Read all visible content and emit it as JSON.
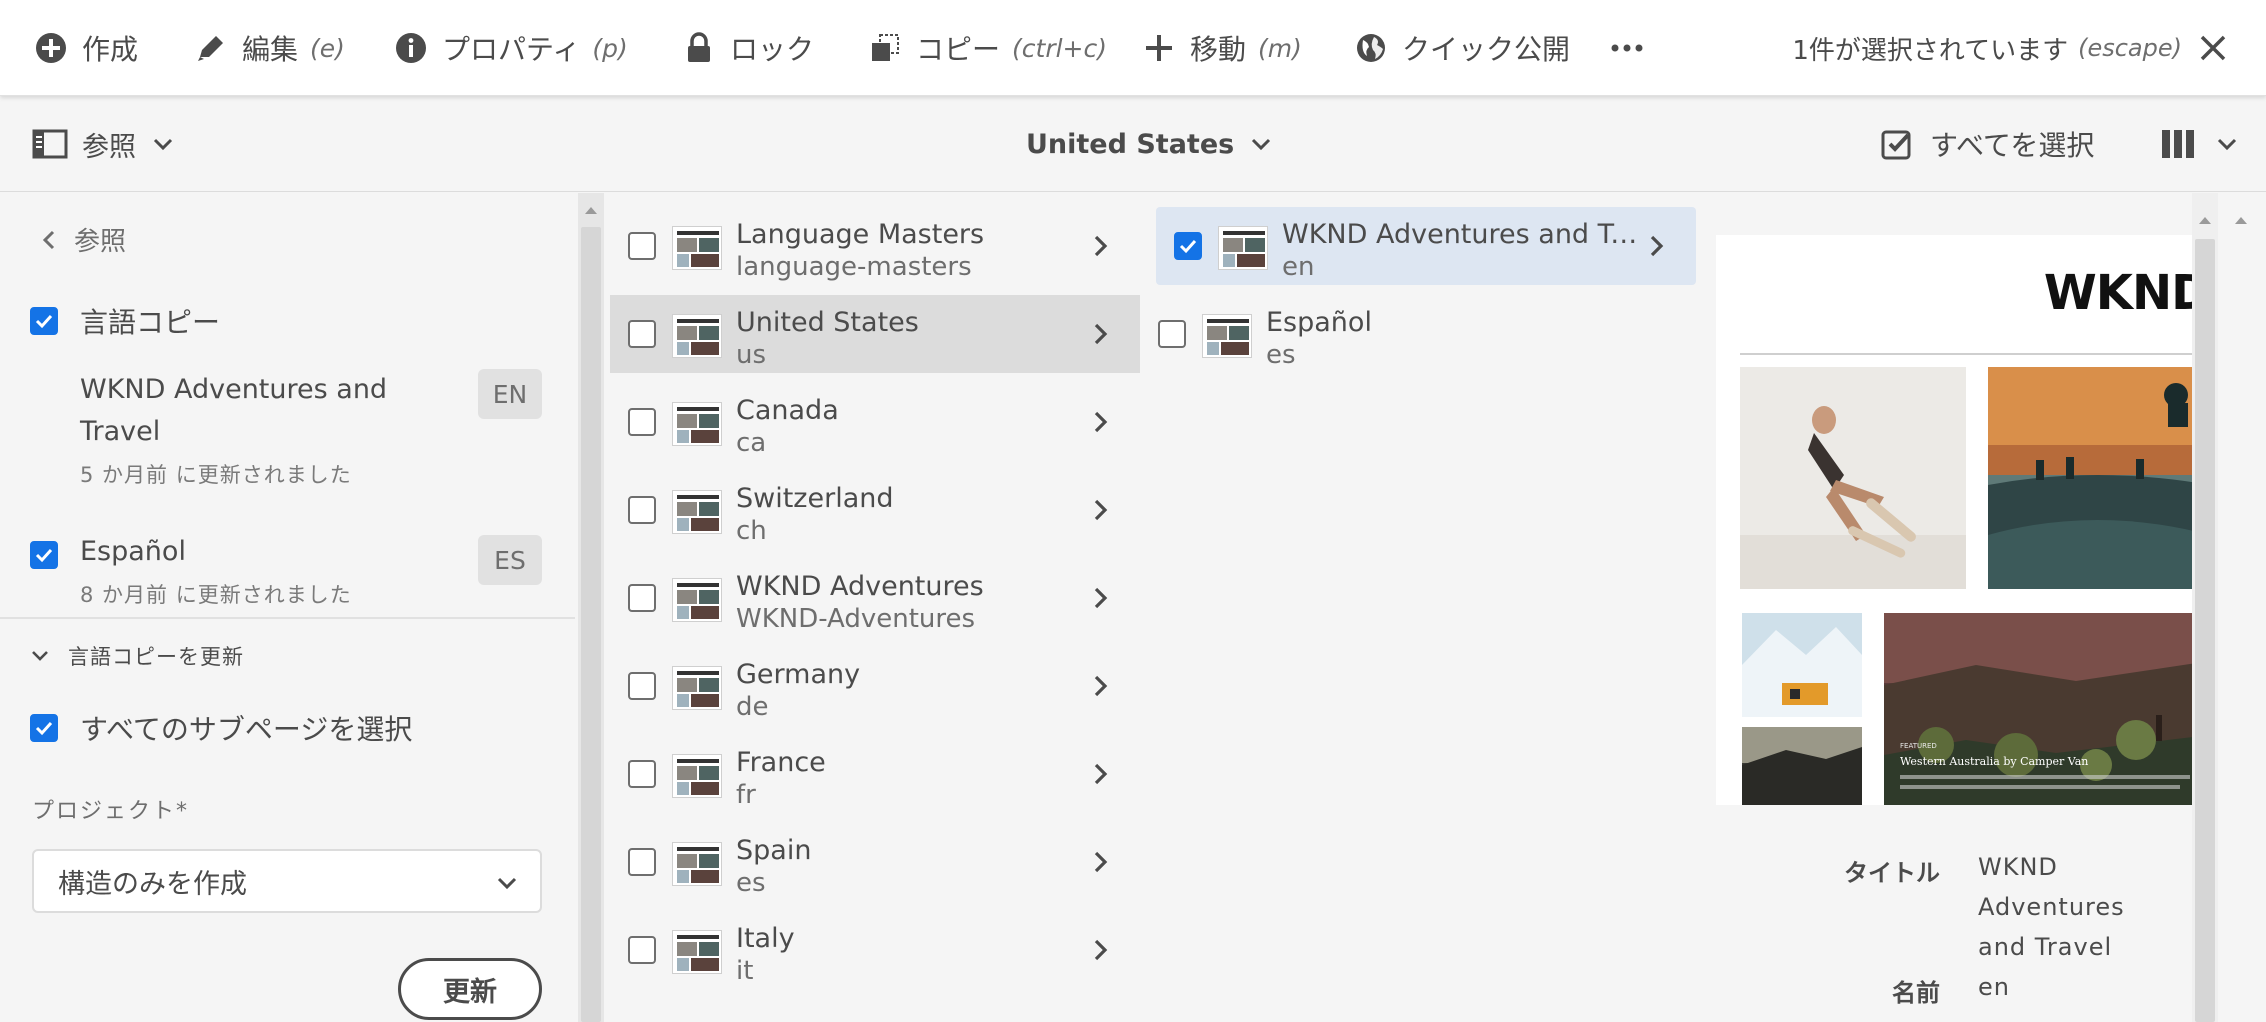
{
  "actionbar": {
    "create": "作成",
    "edit": "編集",
    "edit_kb": "(e)",
    "properties": "プロパティ",
    "properties_kb": "(p)",
    "lock": "ロック",
    "copy": "コピー",
    "copy_kb": "(ctrl+c)",
    "move": "移動",
    "move_kb": "(m)",
    "quick_publish": "クイック公開",
    "selection_status": "1件が選択されています",
    "selection_kb": "(escape)"
  },
  "subbar": {
    "rail_toggle": "参照",
    "breadcrumb": "United States",
    "select_all": "すべてを選択"
  },
  "rail": {
    "back": "参照",
    "language_copies_label": "言語コピー",
    "items": [
      {
        "title": "WKND Adventures and Travel",
        "badge": "EN",
        "updated": "5 か月前 に更新されました",
        "checked": false
      },
      {
        "title": "Español",
        "badge": "ES",
        "updated": "8 か月前 に更新されました",
        "checked": true
      }
    ],
    "update_section": "言語コピーを更新",
    "select_subpages": "すべてのサブページを選択",
    "project_label": "プロジェクト*",
    "project_value": "構造のみを作成",
    "update_button": "更新"
  },
  "column1": [
    {
      "title": "Language Masters",
      "name": "language-masters",
      "active": false
    },
    {
      "title": "United States",
      "name": "us",
      "active": true
    },
    {
      "title": "Canada",
      "name": "ca",
      "active": false
    },
    {
      "title": "Switzerland",
      "name": "ch",
      "active": false
    },
    {
      "title": "WKND Adventures",
      "name": "WKND-Adventures",
      "active": false
    },
    {
      "title": "Germany",
      "name": "de",
      "active": false
    },
    {
      "title": "France",
      "name": "fr",
      "active": false
    },
    {
      "title": "Spain",
      "name": "es",
      "active": false
    },
    {
      "title": "Italy",
      "name": "it",
      "active": false
    }
  ],
  "column2": [
    {
      "title": "WKND Adventures and Tr…",
      "name": "en",
      "selected": true
    },
    {
      "title": "Español",
      "name": "es",
      "selected": false
    }
  ],
  "preview": {
    "logo": "WKND",
    "featured": "FEATURED",
    "article_title": "Western Australia by Camper Van",
    "meta": [
      {
        "key": "タイトル",
        "value": "WKND Adventures and Travel"
      },
      {
        "key": "名前",
        "value": "en"
      }
    ]
  },
  "colors": {
    "accent": "#1473e6",
    "selected_row": "#dde6f2",
    "active_row": "#dcdcdc"
  }
}
